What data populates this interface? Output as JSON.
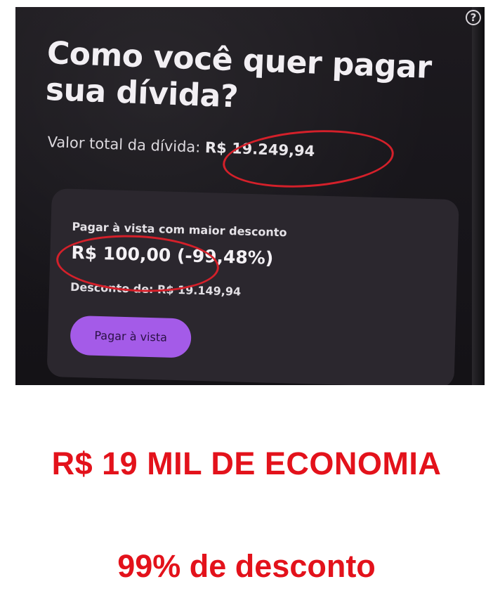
{
  "screen": {
    "help_icon": "question-circle-icon",
    "help_symbol": "?",
    "title": "Como você quer pagar sua dívida?",
    "total_label": "Valor total da dívida: ",
    "total_amount": "R$ 19.249,94"
  },
  "offer_card": {
    "heading": "Pagar à vista com maior desconto",
    "price": "R$ 100,00 (-99,48%)",
    "discount": "Desconto de: R$ 19.149,94",
    "button_label": "Pagar à vista"
  },
  "caption": {
    "headline": "R$ 19 MIL DE ECONOMIA",
    "subline": "99% de desconto"
  },
  "colors": {
    "caption_red": "#e3121b",
    "annotation_red": "#d4202a",
    "button_purple": "#a45be8",
    "screen_background": "#1d1a1f",
    "card_background": "#2b272e"
  }
}
